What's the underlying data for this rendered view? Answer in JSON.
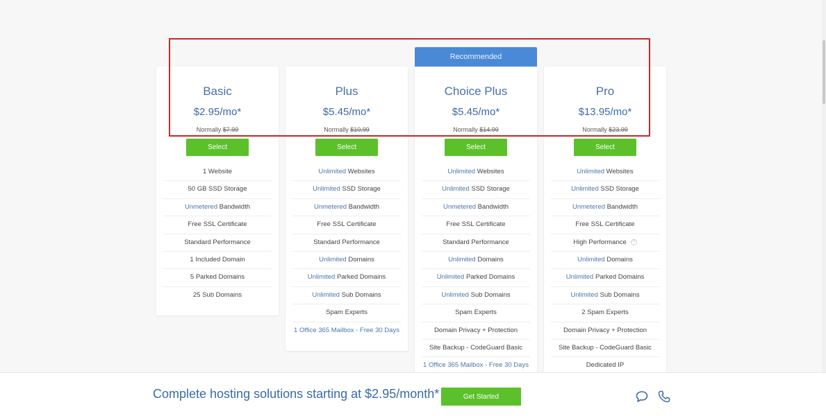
{
  "recommended_label": "Recommended",
  "plans": [
    {
      "name": "Basic",
      "price": "$2.95/mo*",
      "normally_label": "Normally",
      "normal_price": "$7.99",
      "select_label": "Select",
      "features": [
        {
          "hl": "",
          "text": "1 Website"
        },
        {
          "hl": "",
          "text": "50 GB SSD Storage"
        },
        {
          "hl": "Unmetered",
          "text": " Bandwidth"
        },
        {
          "hl": "",
          "text": "Free SSL Certificate"
        },
        {
          "hl": "",
          "text": "Standard Performance"
        },
        {
          "hl": "",
          "text": "1 Included Domain"
        },
        {
          "hl": "",
          "text": "5 Parked Domains"
        },
        {
          "hl": "",
          "text": "25 Sub Domains"
        }
      ]
    },
    {
      "name": "Plus",
      "price": "$5.45/mo*",
      "normally_label": "Normally",
      "normal_price": "$10.99",
      "select_label": "Select",
      "features": [
        {
          "hl": "Unlimited",
          "text": " Websites"
        },
        {
          "hl": "Unlimited",
          "text": " SSD Storage"
        },
        {
          "hl": "Unmetered",
          "text": " Bandwidth"
        },
        {
          "hl": "",
          "text": "Free SSL Certificate"
        },
        {
          "hl": "",
          "text": "Standard Performance"
        },
        {
          "hl": "Unlimited",
          "text": " Domains"
        },
        {
          "hl": "Unlimited",
          "text": " Parked Domains"
        },
        {
          "hl": "Unlimited",
          "text": " Sub Domains"
        },
        {
          "hl": "",
          "text": "Spam Experts"
        },
        {
          "hl": "1 Office 365 Mailbox - Free 30 Days",
          "text": ""
        }
      ]
    },
    {
      "name": "Choice Plus",
      "price": "$5.45/mo*",
      "normally_label": "Normally",
      "normal_price": "$14.99",
      "select_label": "Select",
      "features": [
        {
          "hl": "Unlimited",
          "text": " Websites"
        },
        {
          "hl": "Unlimited",
          "text": " SSD Storage"
        },
        {
          "hl": "Unmetered",
          "text": " Bandwidth"
        },
        {
          "hl": "",
          "text": "Free SSL Certificate"
        },
        {
          "hl": "",
          "text": "Standard Performance"
        },
        {
          "hl": "Unlimited",
          "text": " Domains"
        },
        {
          "hl": "Unlimited",
          "text": " Parked Domains"
        },
        {
          "hl": "Unlimited",
          "text": " Sub Domains"
        },
        {
          "hl": "",
          "text": "Spam Experts"
        },
        {
          "hl": "",
          "text": "Domain Privacy + Protection"
        },
        {
          "hl": "",
          "text": "Site Backup - CodeGuard Basic"
        },
        {
          "hl": "1 Office 365 Mailbox - Free 30 Days",
          "text": ""
        }
      ]
    },
    {
      "name": "Pro",
      "price": "$13.95/mo*",
      "normally_label": "Normally",
      "normal_price": "$23.99",
      "select_label": "Select",
      "features": [
        {
          "hl": "Unlimited",
          "text": " Websites"
        },
        {
          "hl": "Unlimited",
          "text": " SSD Storage"
        },
        {
          "hl": "Unmetered",
          "text": " Bandwidth"
        },
        {
          "hl": "",
          "text": "Free SSL Certificate"
        },
        {
          "hl": "",
          "text": "High Performance",
          "info": true
        },
        {
          "hl": "Unlimited",
          "text": " Domains"
        },
        {
          "hl": "Unlimited",
          "text": " Parked Domains"
        },
        {
          "hl": "Unlimited",
          "text": " Sub Domains"
        },
        {
          "hl": "",
          "text": "2 Spam Experts"
        },
        {
          "hl": "",
          "text": "Domain Privacy + Protection"
        },
        {
          "hl": "",
          "text": "Site Backup - CodeGuard Basic"
        },
        {
          "hl": "",
          "text": "Dedicated IP"
        }
      ]
    }
  ],
  "bottom_bar": {
    "text": "Complete hosting solutions starting at $2.95/month*",
    "cta_label": "Get Started",
    "icons": [
      "chat-icon",
      "phone-icon"
    ]
  },
  "colors": {
    "accent_blue": "#3a6aa8",
    "recommended_bg": "#4a89d6",
    "button_green": "#5cc02b",
    "highlight_border": "#c62828"
  }
}
